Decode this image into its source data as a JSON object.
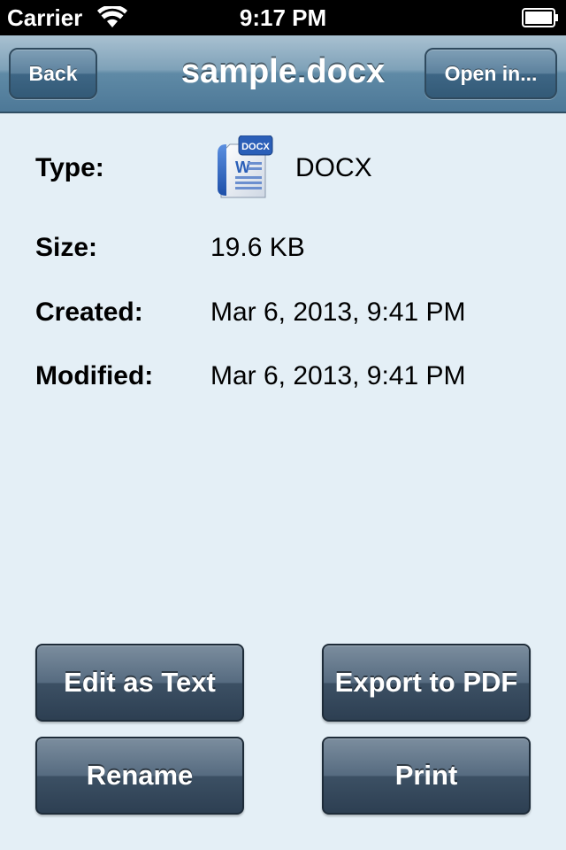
{
  "status_bar": {
    "carrier": "Carrier",
    "time": "9:17 PM"
  },
  "nav": {
    "title": "sample.docx",
    "back_label": "Back",
    "open_in_label": "Open in..."
  },
  "info": {
    "type_label": "Type:",
    "type_value": "DOCX",
    "type_icon": "docx-file-icon",
    "size_label": "Size:",
    "size_value": "19.6 KB",
    "created_label": "Created:",
    "created_value": "Mar 6, 2013, 9:41 PM",
    "modified_label": "Modified:",
    "modified_value": "Mar 6, 2013, 9:41 PM"
  },
  "actions": {
    "edit_as_text": "Edit as Text",
    "export_to_pdf": "Export to PDF",
    "rename": "Rename",
    "print": "Print"
  },
  "icon_badge": "DOCX",
  "colors": {
    "background": "#e4eff6",
    "nav_bar": "#5f8aa6",
    "action_button": "#3c5064"
  }
}
